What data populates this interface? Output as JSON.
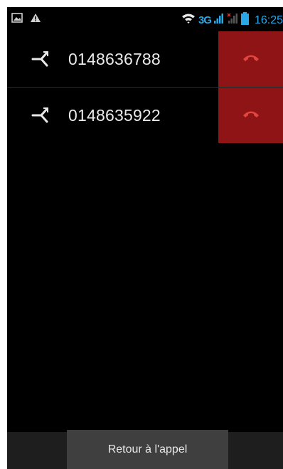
{
  "status_bar": {
    "left_icons": [
      "image-icon",
      "warning-icon"
    ],
    "right_icons": [
      "wifi-icon",
      "signal-icon",
      "no-signal-icon",
      "battery-icon"
    ],
    "network_type": "3G",
    "time": "16:25",
    "accent_color": "#2aa7e5"
  },
  "calls": [
    {
      "number": "0148636788",
      "icon": "merge-calls-icon",
      "end_icon": "end-call-icon"
    },
    {
      "number": "0148635922",
      "icon": "merge-calls-icon",
      "end_icon": "end-call-icon"
    }
  ],
  "colors": {
    "end_call_bg": "#8e1416",
    "end_call_glyph": "#e0463f"
  },
  "footer": {
    "return_label": "Retour à l'appel"
  }
}
